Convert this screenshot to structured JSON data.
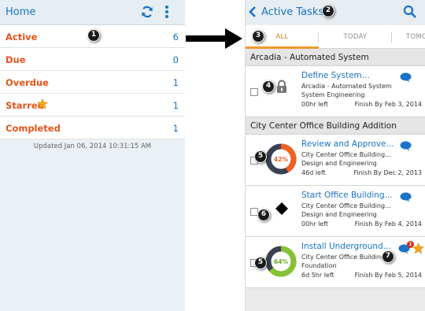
{
  "colors": {
    "accent": "#1a73c8",
    "status_orange": "#e4541b",
    "tab_active": "#f0992c",
    "progress_orange": "#f06020",
    "progress_green": "#86c234",
    "progress_dark": "#3a4050"
  },
  "left": {
    "title": "Home",
    "icons": [
      "refresh-icon",
      "overflow-menu-icon"
    ],
    "rows": [
      {
        "label": "Active",
        "count": "6"
      },
      {
        "label": "Due",
        "count": "0"
      },
      {
        "label": "Overdue",
        "count": "1"
      },
      {
        "label": "Starred",
        "count": "1",
        "icon": "star-icon"
      },
      {
        "label": "Completed",
        "count": "1"
      }
    ],
    "updated": "Updated Jan 06, 2014 10:31:15 AM"
  },
  "right": {
    "title": "Active Tasks",
    "icons": [
      "back-icon",
      "search-icon"
    ],
    "tabs": [
      "ALL",
      "TODAY",
      "TOMO"
    ],
    "sections": [
      {
        "name": "Arcadia - Automated System",
        "tasks": [
          {
            "name": "Define System...",
            "project": "Arcadia - Automated System",
            "phase": "System Engineering",
            "left": "00hr left",
            "finish": "Finish By Feb 3, 2014",
            "indicator": "lock-icon"
          }
        ]
      },
      {
        "name": "City Center Office Building Addition",
        "tasks": [
          {
            "name": "Review and Approve...",
            "project": "City Center Office Building...",
            "phase": "Design and Engineering",
            "left": "46d left",
            "finish": "Finish By Dec 2, 2013",
            "progress": "42%",
            "progress_value": 42
          },
          {
            "name": "Start Office Building...",
            "project": "City Center Office Building...",
            "phase": "Design and Engineering",
            "left": "00hr left",
            "finish": "Finish By Feb 4, 2014",
            "indicator": "milestone-diamond-icon"
          },
          {
            "name": "Install Underground...",
            "project": "City Center Office Building...",
            "phase": "Foundation",
            "left": "6d 5hr left",
            "finish": "Finish By Feb 5, 2014",
            "progress": "64%",
            "progress_value": 64,
            "badge": "1"
          }
        ]
      }
    ]
  },
  "callouts": [
    "1",
    "2",
    "3",
    "4",
    "5",
    "6",
    "7",
    "5"
  ]
}
